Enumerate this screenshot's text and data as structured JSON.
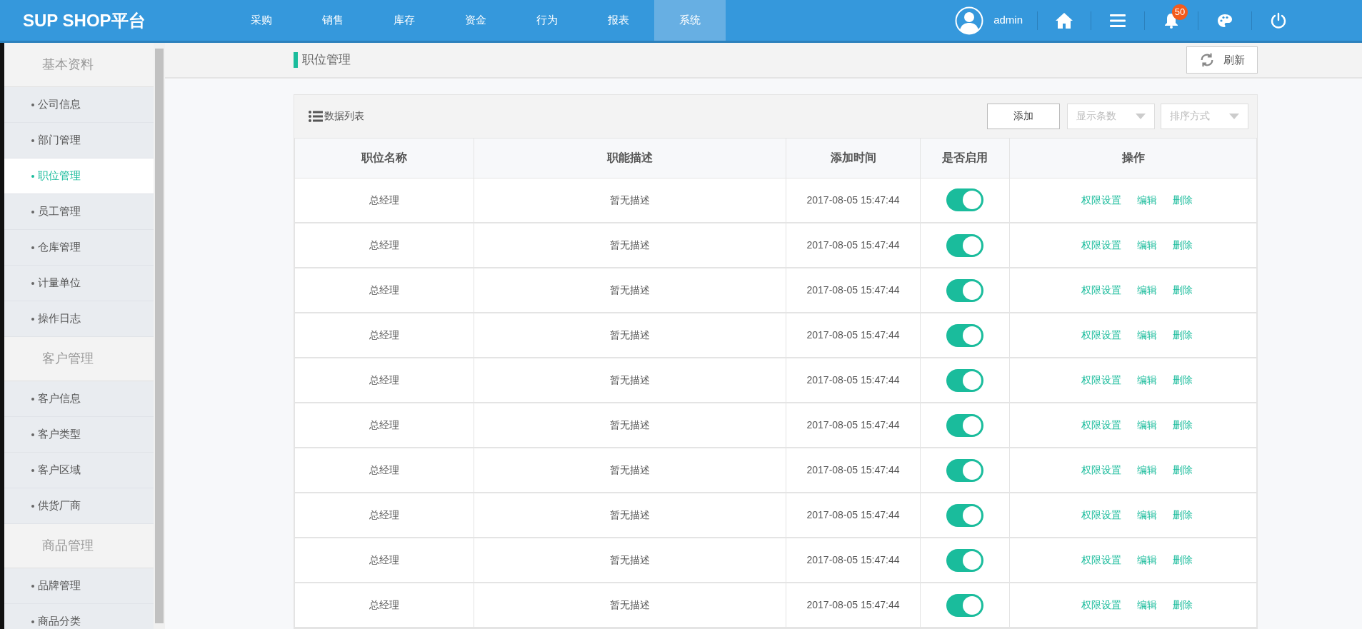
{
  "header": {
    "logo": "SUP SHOP平台",
    "nav": [
      {
        "label": "采购",
        "selected": false
      },
      {
        "label": "销售",
        "selected": false
      },
      {
        "label": "库存",
        "selected": false
      },
      {
        "label": "资金",
        "selected": false
      },
      {
        "label": "行为",
        "selected": false
      },
      {
        "label": "报表",
        "selected": false
      },
      {
        "label": "系统",
        "selected": true
      }
    ],
    "user": "admin",
    "notification_count": "50"
  },
  "sidebar": {
    "groups": [
      {
        "title": "基本资料",
        "items": [
          {
            "label": "公司信息",
            "selected": false
          },
          {
            "label": "部门管理",
            "selected": false
          },
          {
            "label": "职位管理",
            "selected": true
          },
          {
            "label": "员工管理",
            "selected": false
          },
          {
            "label": "仓库管理",
            "selected": false
          },
          {
            "label": "计量单位",
            "selected": false
          },
          {
            "label": "操作日志",
            "selected": false
          }
        ]
      },
      {
        "title": "客户管理",
        "items": [
          {
            "label": "客户信息",
            "selected": false
          },
          {
            "label": "客户类型",
            "selected": false
          },
          {
            "label": "客户区域",
            "selected": false
          },
          {
            "label": "供货厂商",
            "selected": false
          }
        ]
      },
      {
        "title": "商品管理",
        "items": [
          {
            "label": "品牌管理",
            "selected": false
          },
          {
            "label": "商品分类",
            "selected": false
          }
        ]
      }
    ]
  },
  "page": {
    "title": "职位管理",
    "refresh": "刷新"
  },
  "panel": {
    "title": "数据列表",
    "add": "添加",
    "page_size_placeholder": "显示条数",
    "sort_placeholder": "排序方式"
  },
  "table": {
    "columns": [
      "职位名称",
      "职能描述",
      "添加时间",
      "是否启用",
      "操作"
    ],
    "rows": [
      {
        "name": "总经理",
        "desc": "暂无描述",
        "time": "2017-08-05 15:47:44",
        "enabled": true,
        "actions": [
          "权限设置",
          "编辑",
          "删除"
        ]
      },
      {
        "name": "总经理",
        "desc": "暂无描述",
        "time": "2017-08-05 15:47:44",
        "enabled": true,
        "actions": [
          "权限设置",
          "编辑",
          "删除"
        ]
      },
      {
        "name": "总经理",
        "desc": "暂无描述",
        "time": "2017-08-05 15:47:44",
        "enabled": true,
        "actions": [
          "权限设置",
          "编辑",
          "删除"
        ]
      },
      {
        "name": "总经理",
        "desc": "暂无描述",
        "time": "2017-08-05 15:47:44",
        "enabled": true,
        "actions": [
          "权限设置",
          "编辑",
          "删除"
        ]
      },
      {
        "name": "总经理",
        "desc": "暂无描述",
        "time": "2017-08-05 15:47:44",
        "enabled": true,
        "actions": [
          "权限设置",
          "编辑",
          "删除"
        ]
      },
      {
        "name": "总经理",
        "desc": "暂无描述",
        "time": "2017-08-05 15:47:44",
        "enabled": true,
        "actions": [
          "权限设置",
          "编辑",
          "删除"
        ]
      },
      {
        "name": "总经理",
        "desc": "暂无描述",
        "time": "2017-08-05 15:47:44",
        "enabled": true,
        "actions": [
          "权限设置",
          "编辑",
          "删除"
        ]
      },
      {
        "name": "总经理",
        "desc": "暂无描述",
        "time": "2017-08-05 15:47:44",
        "enabled": true,
        "actions": [
          "权限设置",
          "编辑",
          "删除"
        ]
      },
      {
        "name": "总经理",
        "desc": "暂无描述",
        "time": "2017-08-05 15:47:44",
        "enabled": true,
        "actions": [
          "权限设置",
          "编辑",
          "删除"
        ]
      },
      {
        "name": "总经理",
        "desc": "暂无描述",
        "time": "2017-08-05 15:47:44",
        "enabled": true,
        "actions": [
          "权限设置",
          "编辑",
          "删除"
        ]
      }
    ]
  }
}
